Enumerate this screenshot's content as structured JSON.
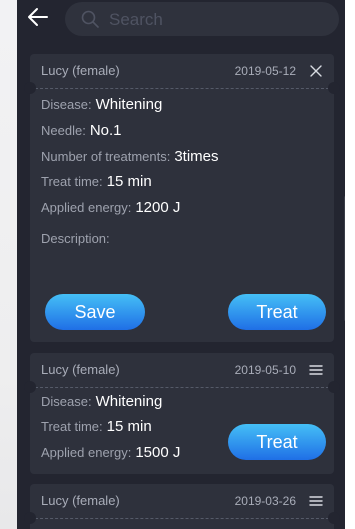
{
  "header": {
    "search_placeholder": "Search",
    "back_icon": "arrow-left-icon",
    "search_icon": "search-icon"
  },
  "colors": {
    "background": "#232530",
    "card": "#2e313c",
    "accent_gradient_top": "#45bff6",
    "accent_gradient_bottom": "#1f6fe6"
  },
  "cards": [
    {
      "patient": "Lucy (female)",
      "date": "2019-05-12",
      "action_icon": "close-icon",
      "disease_label": "Disease:",
      "disease": "Whitening",
      "needle_label": "Needle:",
      "needle": "No.1",
      "treatments_label": "Number of treatments:",
      "treatments": "3times",
      "treat_time_label": "Treat time:",
      "treat_time": "15 min",
      "energy_label": "Applied energy:",
      "energy": "1200 J",
      "description_label": "Description:",
      "save_label": "Save",
      "treat_label": "Treat"
    },
    {
      "patient": "Lucy (female)",
      "date": "2019-05-10",
      "action_icon": "menu-icon",
      "disease_label": "Disease:",
      "disease": "Whitening",
      "treat_time_label": "Treat time:",
      "treat_time": "15 min",
      "energy_label": "Applied energy:",
      "energy": "1500 J",
      "treat_label": "Treat"
    },
    {
      "patient": "Lucy (female)",
      "date": "2019-03-26",
      "action_icon": "menu-icon"
    }
  ]
}
